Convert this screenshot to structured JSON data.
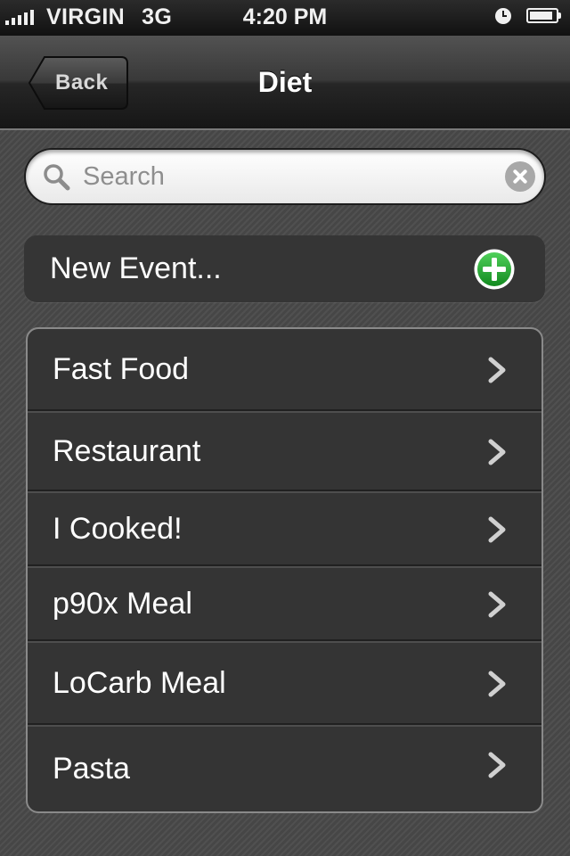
{
  "status_bar": {
    "carrier": "VIRGIN",
    "network": "3G",
    "time": "4:20 PM",
    "signal_bars": 5,
    "battery_level": 0.9,
    "icons": [
      "signal-icon",
      "alarm-icon",
      "battery-icon"
    ]
  },
  "nav": {
    "back_label": "Back",
    "title": "Diet"
  },
  "search": {
    "placeholder": "Search",
    "value": "",
    "icons": [
      "search-icon",
      "clear-icon"
    ]
  },
  "new_event": {
    "label": "New Event...",
    "icon": "add-icon",
    "icon_color": "#1e9a2c"
  },
  "list": {
    "items": [
      {
        "label": "Fast Food"
      },
      {
        "label": "Restaurant"
      },
      {
        "label": "I Cooked!"
      },
      {
        "label": "p90x Meal"
      },
      {
        "label": "LoCarb Meal"
      },
      {
        "label": "Pasta"
      }
    ],
    "item_icon": "chevron-right-icon"
  },
  "colors": {
    "background": "#4a4a4a",
    "cell": "#343434",
    "text": "#ffffff",
    "chevron": "#d0d0d0"
  }
}
